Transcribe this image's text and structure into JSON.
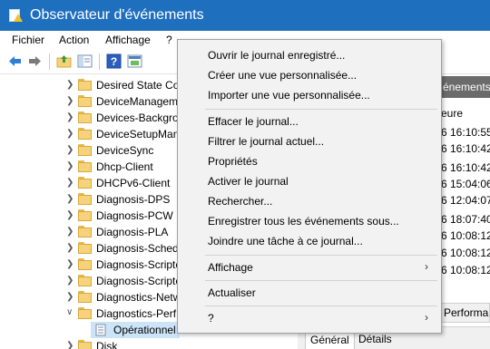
{
  "window": {
    "title": "Observateur d'événements"
  },
  "menu": [
    "Fichier",
    "Action",
    "Affichage",
    "?"
  ],
  "toolbar": {
    "icons": [
      "back-arrow-icon",
      "forward-arrow-icon",
      "folder-up-icon",
      "show-hide-tree-icon",
      "help-icon",
      "properties-icon"
    ]
  },
  "tree": {
    "items": [
      "Desired State Con",
      "DeviceManageme",
      "Devices-Backgro",
      "DeviceSetupMan",
      "DeviceSync",
      "Dhcp-Client",
      "DHCPv6-Client",
      "Diagnosis-DPS",
      "Diagnosis-PCW",
      "Diagnosis-PLA",
      "Diagnosis-Sched",
      "Diagnosis-Scripte",
      "Diagnosis-Scripte",
      "Diagnostics-Netw",
      "Diagnostics-Perf",
      "Opérationnel",
      "Disk"
    ]
  },
  "right_panel": {
    "header": "énements",
    "column": "eure",
    "times": [
      "6 16:10:55",
      "6 16:10:42",
      "6 16:10:42",
      "6 15:04:06",
      "6 12:04:07",
      "6 18:07:40",
      "6 10:08:12",
      "6 10:08:12",
      "6 10:08:12"
    ],
    "perf_label": "Performan",
    "tabs": [
      "Général",
      "Détails"
    ]
  },
  "context_menu": {
    "groups": [
      [
        "Ouvrir le journal enregistré...",
        "Créer une vue personnalisée...",
        "Importer une vue personnalisée..."
      ],
      [
        "Effacer le journal...",
        "Filtrer le journal actuel...",
        "Propriétés",
        "Activer le journal",
        "Rechercher...",
        "Enregistrer tous les événements sous...",
        "Joindre une tâche à ce journal..."
      ],
      [
        "Affichage"
      ],
      [
        "Actualiser"
      ],
      [
        "?"
      ]
    ],
    "submenu_arrow": "›"
  },
  "colors": {
    "titlebar": "#1f6fbf",
    "highlight": "#f7f51d",
    "selection": "#cce4f7"
  }
}
